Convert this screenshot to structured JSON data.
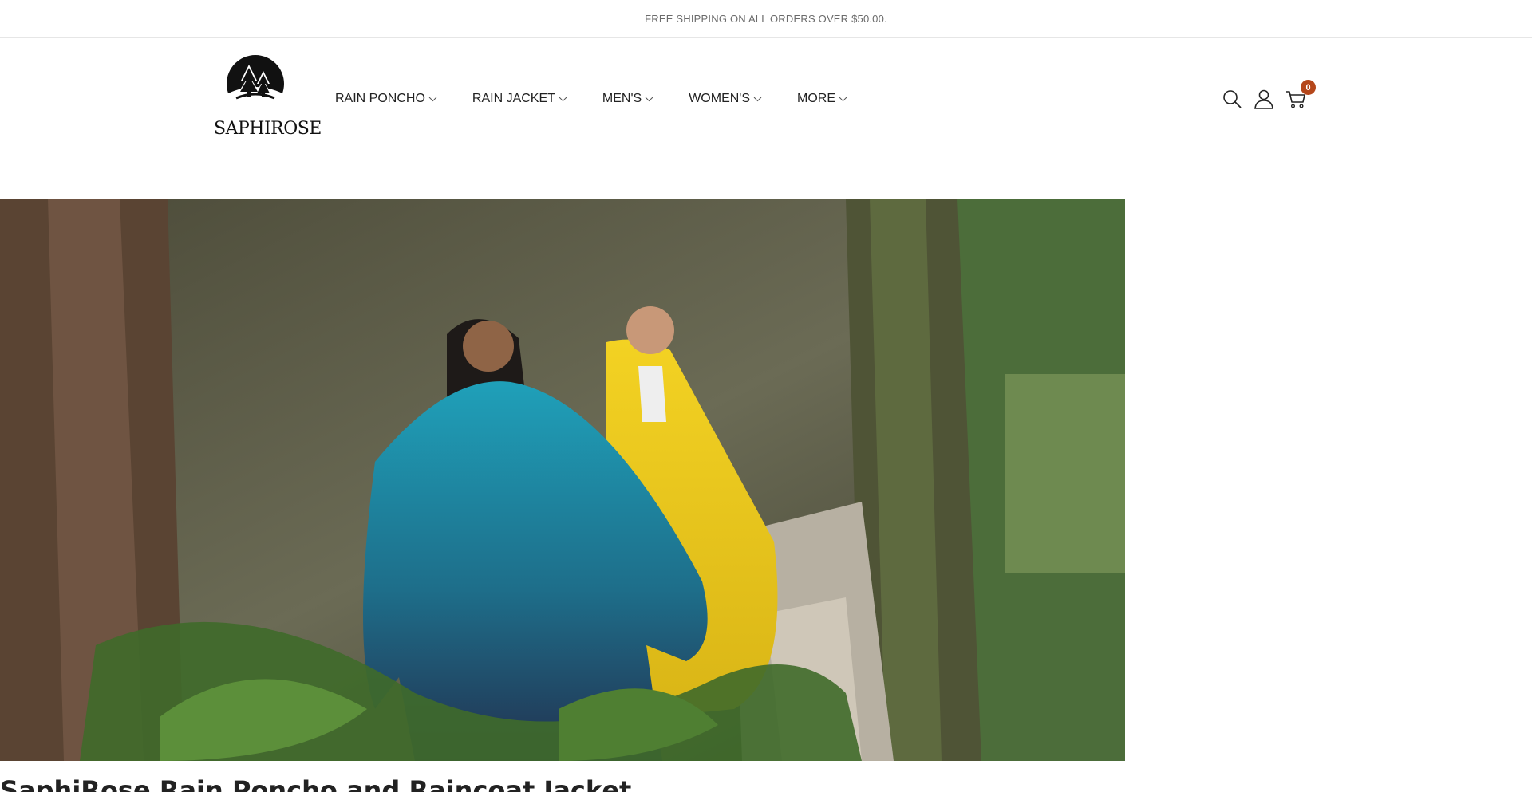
{
  "announcement": {
    "text": "FREE SHIPPING ON ALL ORDERS OVER $50.00."
  },
  "brand": {
    "name": "SAPHIROSE"
  },
  "nav": {
    "items": [
      {
        "label": "RAIN PONCHO"
      },
      {
        "label": "RAIN JACKET"
      },
      {
        "label": "MEN'S"
      },
      {
        "label": "WOMEN'S"
      },
      {
        "label": "MORE"
      }
    ]
  },
  "header_icons": {
    "search": "search-icon",
    "account": "user-icon",
    "cart": "cart-icon",
    "cart_count": "0"
  },
  "hero": {
    "image": "two-hikers-in-rain-ponchos-forest"
  },
  "product": {
    "title": "SaphiRose Rain Poncho and Raincoat Jacket"
  },
  "colors": {
    "badge": "#b5471b",
    "text": "#222222",
    "muted": "#6b6b6b"
  }
}
